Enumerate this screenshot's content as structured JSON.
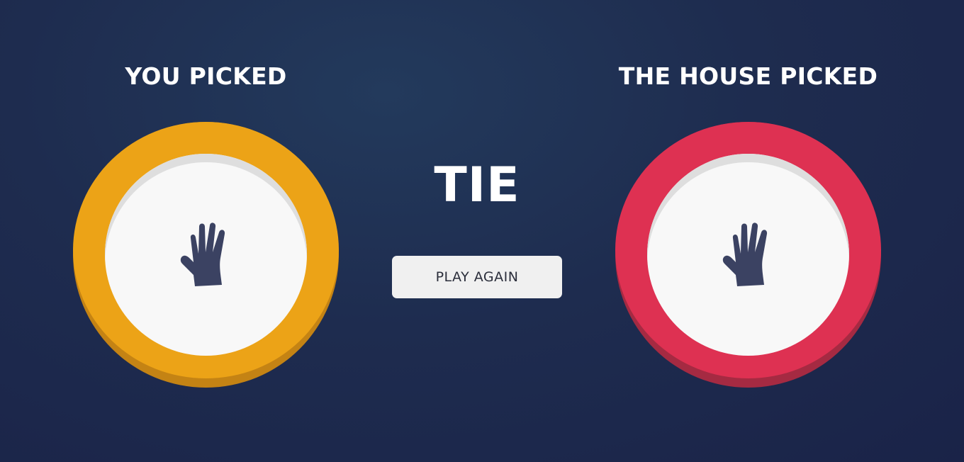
{
  "player": {
    "title": "YOU PICKED",
    "choice": "paper",
    "icon": "hand-paper-icon",
    "ring_color": "#eca317",
    "ring_shadow_color": "#c48314"
  },
  "house": {
    "title": "THE HOUSE PICKED",
    "choice": "paper",
    "icon": "hand-paper-icon",
    "ring_color": "#de3152",
    "ring_shadow_color": "#a52a42"
  },
  "result": {
    "text": "TIE",
    "button_label": "PLAY AGAIN"
  },
  "colors": {
    "icon_fill": "#3b4262",
    "inner_face": "#f8f8f8",
    "text": "#ffffff"
  }
}
